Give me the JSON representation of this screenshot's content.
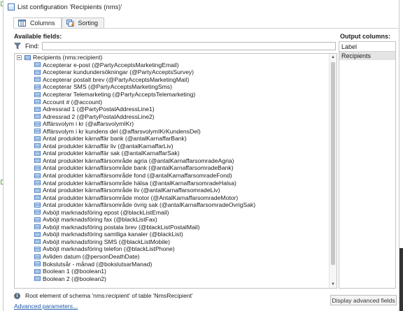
{
  "window": {
    "title": "List configuration 'Recipients (nms)'"
  },
  "tabs": [
    {
      "label": "Columns",
      "icon": "columns-icon",
      "active": true
    },
    {
      "label": "Sorting",
      "icon": "sorting-icon",
      "active": false
    }
  ],
  "available": {
    "label": "Available fields:",
    "find_label": "Find:",
    "find_value": "",
    "root": "Recipients (nms:recipient)",
    "fields": [
      "Accepterar e-post (@PartyAcceptsMarketingEmail)",
      "Accepterar kundundersökningar (@PartyAcceptsSurvey)",
      "Accepterar postalt brev (@PartyAcceptsMarketingMail)",
      "Accepterar SMS (@PartyAcceptsMarketingSms)",
      "Accepterar Telemarketing (@PartyAcceptsTelemarketing)",
      "Account # (@account)",
      "Adressrad 1 (@PartyPostalAddressLine1)",
      "Adressrad 2 (@PartyPostalAddressLine2)",
      "Affärsvolym i kr (@affarsvolymIKr)",
      "Affärsvolym i kr kundens del (@affarsvolymIKrKundensDel)",
      "Antal produkter kärnaffär bank (@antalKarnaffarBank)",
      "Antal produkter kärnaffär liv (@antalKarnaffarLiv)",
      "Antal produkter kärnaffär sak (@antalKarnaffarSak)",
      "Antal produkter kärnaffärsområde agria (@antalKarnaffarsomradeAgria)",
      "Antal produkter kärnaffärsområde bank (@antalKarnaffarsomradeBank)",
      "Antal produkter kärnaffärsområde fond (@antalKarnaffarsomradeFond)",
      "Antal produkter kärnaffärsområde hälsa (@antalKarnaffarsomradeHalsa)",
      "Antal produkter kärnaffärsområde liv (@antalKarnaffarsomradeLiv)",
      "Antal produkter kärnaffärsområde motor (@AntalKarnaffarsomradeMotor)",
      "Antal produkter kärnaffärsområde övrig sak (@antalKarnaffarsomradeOvrigSak)",
      "Avböjt marknadsföring epost (@blackListEmail)",
      "Avböjt marknadsföring fax (@blackListFax)",
      "Avböjt marknadsföring postala brev (@blackListPostalMail)",
      "Avböjt marknadsföring samtliga kanaler (@blackList)",
      "Avböjt marknadsföring SMS (@blackListMobile)",
      "Avböjt marknadsföring telefon (@blackListPhone)",
      "Avliden datum (@personDeathDate)",
      "Bokslutsår - månad (@bokslutsarManad)",
      "Boolean 1 (@boolean1)",
      "Boolean 2 (@boolean2)"
    ]
  },
  "output": {
    "label": "Output columns:",
    "header": "Label",
    "items": [
      "Recipients"
    ]
  },
  "status": {
    "text": "Root element of schema 'nms:recipient' of table 'NmsRecipient'"
  },
  "advanced_link": "Advanced parameters...",
  "advanced_button": "Display advanced fields"
}
